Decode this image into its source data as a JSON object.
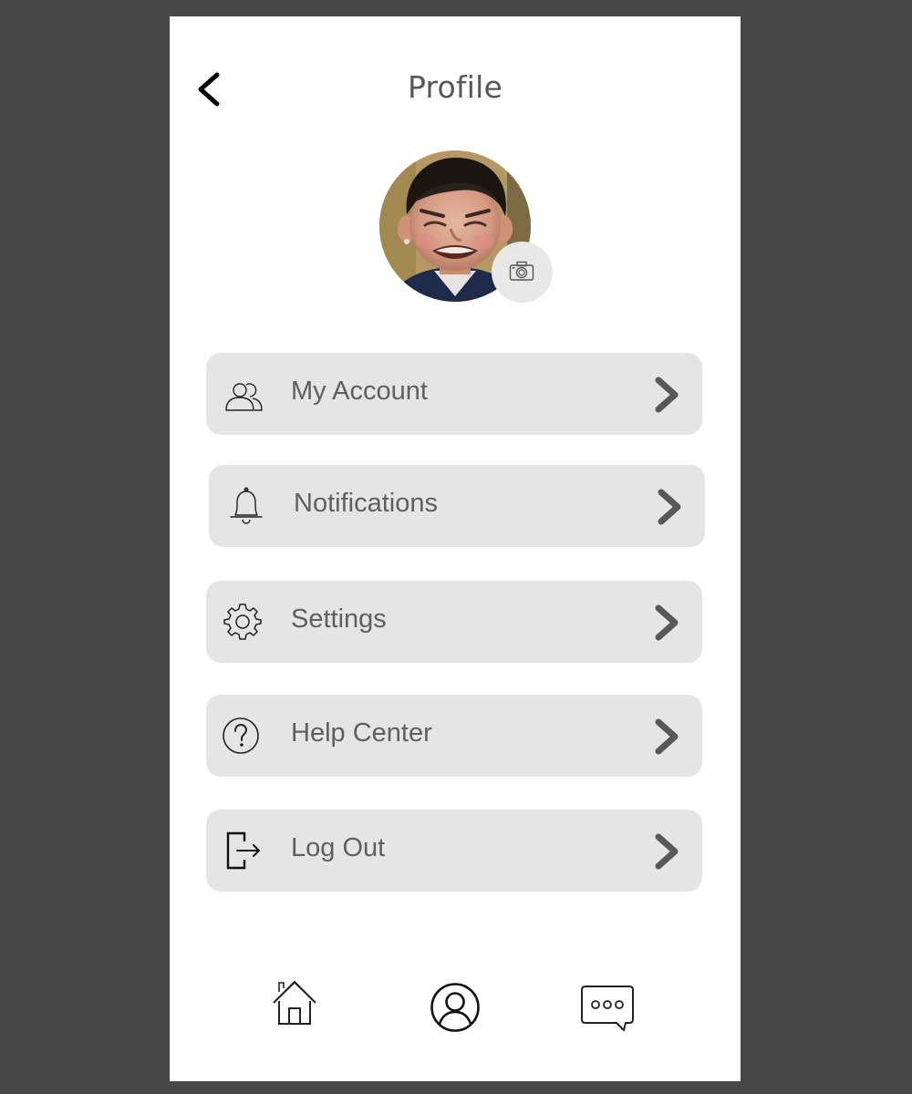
{
  "header": {
    "title": "Profile"
  },
  "menu": {
    "items": [
      {
        "label": "My Account",
        "icon": "users-icon"
      },
      {
        "label": "Notifications",
        "icon": "bell-icon"
      },
      {
        "label": "Settings",
        "icon": "gear-icon"
      },
      {
        "label": "Help Center",
        "icon": "question-circle-icon"
      },
      {
        "label": "Log Out",
        "icon": "logout-icon"
      }
    ]
  },
  "bottom_nav": {
    "items": [
      {
        "icon": "home-icon",
        "active": false
      },
      {
        "icon": "user-circle-icon",
        "active": true
      },
      {
        "icon": "chat-bubble-icon",
        "active": false
      }
    ]
  },
  "colors": {
    "backdrop": "#474747",
    "screen": "#ffffff",
    "menu_item_bg": "#e5e5e5",
    "title_text": "#5b5656",
    "label_text": "#5f5f5f",
    "chevron": "#585858"
  }
}
